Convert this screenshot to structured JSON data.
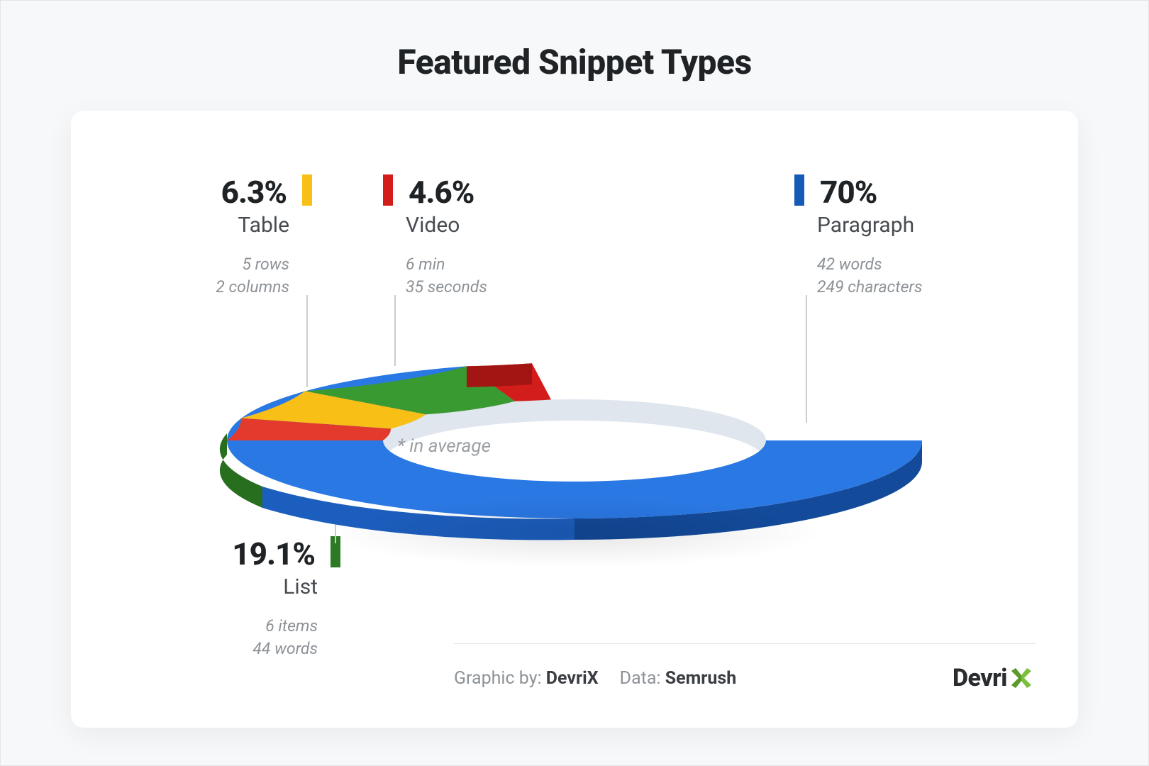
{
  "title": "Featured Snippet Types",
  "center_note": "* in average",
  "credit": {
    "graphic_label": "Graphic by:",
    "graphic_by": "DevriX",
    "data_label": "Data:",
    "data_by": "Semrush",
    "logo_text": "Devri"
  },
  "segments": {
    "paragraph": {
      "pct": "70%",
      "name": "Paragraph",
      "det1": "42 words",
      "det2": "249 characters",
      "color": "#1f6fd6"
    },
    "list": {
      "pct": "19.1%",
      "name": "List",
      "det1": "6 items",
      "det2": "44 words",
      "color": "#3a9a32"
    },
    "table": {
      "pct": "6.3%",
      "name": "Table",
      "det1": "5 rows",
      "det2": "2 columns",
      "color": "#f8bf17"
    },
    "video": {
      "pct": "4.6%",
      "name": "Video",
      "det1": "6 min",
      "det2": "35 seconds",
      "color": "#d21d1b"
    }
  },
  "chart_data": {
    "type": "pie",
    "title": "Featured Snippet Types",
    "series": [
      {
        "name": "Paragraph",
        "value": 70.0,
        "unit": "%",
        "color": "#1f6fd6",
        "details": {
          "words": 42,
          "characters": 249
        }
      },
      {
        "name": "List",
        "value": 19.1,
        "unit": "%",
        "color": "#3a9a32",
        "details": {
          "items": 6,
          "words": 44
        }
      },
      {
        "name": "Table",
        "value": 6.3,
        "unit": "%",
        "color": "#f8bf17",
        "details": {
          "rows": 5,
          "columns": 2
        }
      },
      {
        "name": "Video",
        "value": 4.6,
        "unit": "%",
        "color": "#d21d1b",
        "details": {
          "minutes": 6,
          "seconds": 35
        }
      }
    ],
    "annotations": [
      "* in average"
    ],
    "source": {
      "graphic_by": "DevriX",
      "data": "Semrush"
    }
  }
}
